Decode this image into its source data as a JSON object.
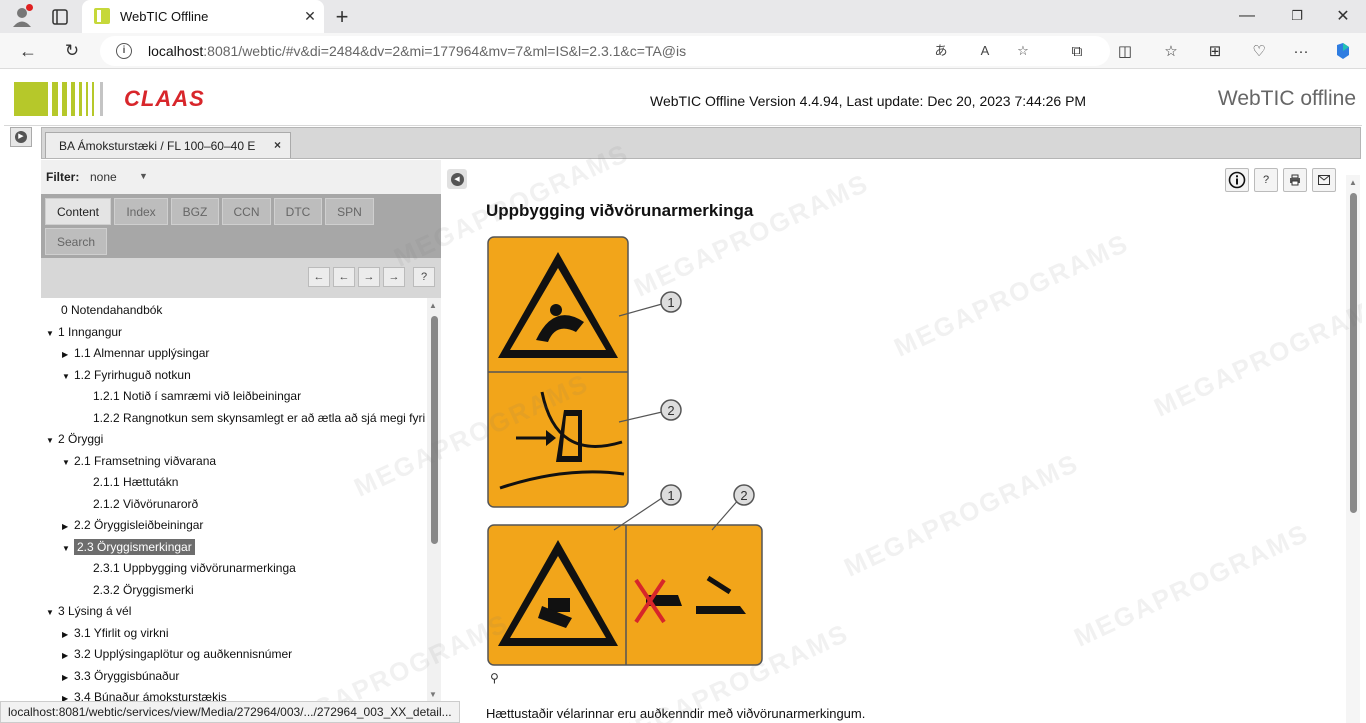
{
  "browser": {
    "tab_title": "WebTIC Offline",
    "url_host": "localhost",
    "url_rest": ":8081/webtic/#v&di=2484&dv=2&mi=177964&mv=7&ml=IS&l=2.3.1&c=TA@is"
  },
  "header": {
    "logo_text": "CLAAS",
    "version_info": "WebTIC Offline Version 4.4.94, Last update: Dec 20, 2023 7:44:26 PM",
    "brand_title": "WebTIC offline"
  },
  "doc_tab": {
    "label": "BA Ámoksturstæki  / FL 100–60–40 E",
    "close": "×"
  },
  "filter": {
    "label": "Filter:",
    "value": "none"
  },
  "nav_tabs": [
    "Content",
    "Index",
    "BGZ",
    "CCN",
    "DTC",
    "SPN",
    "Search"
  ],
  "nav_buttons": [
    "←",
    "←",
    "→",
    "→",
    "?"
  ],
  "tree": [
    {
      "label": "0 Notendahandbók",
      "arrow": ""
    },
    {
      "label": "1 Inngangur",
      "arrow": "▼"
    },
    {
      "label": "1.1 Almennar upplýsingar",
      "arrow": "▶"
    },
    {
      "label": "1.2 Fyrirhuguð notkun",
      "arrow": "▼"
    },
    {
      "label": "1.2.1 Notið í samræmi við leiðbeiningar",
      "arrow": ""
    },
    {
      "label": "1.2.2 Rangnotkun sem skynsamlegt er að ætla að sjá megi fyri",
      "arrow": ""
    },
    {
      "label": "2 Öryggi",
      "arrow": "▼"
    },
    {
      "label": "2.1 Framsetning viðvarana",
      "arrow": "▼"
    },
    {
      "label": "2.1.1 Hættutákn",
      "arrow": ""
    },
    {
      "label": "2.1.2 Viðvörunarorð",
      "arrow": ""
    },
    {
      "label": "2.2 Öryggisleiðbeiningar",
      "arrow": "▶"
    },
    {
      "label": "2.3 Öryggismerkingar",
      "arrow": "▼",
      "selected": true
    },
    {
      "label": "2.3.1 Uppbygging viðvörunarmerkinga",
      "arrow": ""
    },
    {
      "label": "2.3.2 Öryggismerki",
      "arrow": ""
    },
    {
      "label": "3 Lýsing á vél",
      "arrow": "▼"
    },
    {
      "label": "3.1 Yfirlit og virkni",
      "arrow": "▶"
    },
    {
      "label": "3.2 Upplýsingaplötur og auðkennisnúmer",
      "arrow": "▶"
    },
    {
      "label": "3.3 Öryggisbúnaður",
      "arrow": "▶"
    },
    {
      "label": "3.4 Búnaður ámoksturstækis",
      "arrow": "▶"
    }
  ],
  "content": {
    "title": "Uppbygging viðvörunarmerkinga",
    "callouts": [
      "1",
      "2",
      "1",
      "2"
    ],
    "text": "Hættustaðir vélarinnar eru auðkenndir með viðvörunarmerkingum."
  },
  "toolbar_buttons": [
    "i",
    "?",
    "print",
    "mail"
  ],
  "status_bar": "localhost:8081/webtic/services/view/Media/272964/003/.../272964_003_XX_detail...",
  "watermark": "MEGAPROGRAMS",
  "colors": {
    "label_orange": "#f2a51a",
    "claas_red": "#d8262b",
    "claas_green": "#b6c82a"
  }
}
